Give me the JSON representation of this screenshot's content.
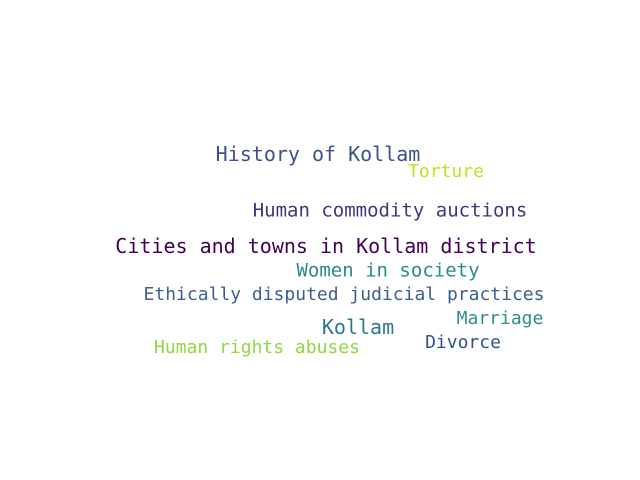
{
  "word_cloud": {
    "words": [
      {
        "text": "History of Kollam",
        "color": "#3b528b"
      },
      {
        "text": "Torture",
        "color": "#c2df23"
      },
      {
        "text": "Human commodity auctions",
        "color": "#46327e"
      },
      {
        "text": "Cities and towns in Kollam district",
        "color": "#440154"
      },
      {
        "text": "Women in society",
        "color": "#2c8a8c"
      },
      {
        "text": "Ethically disputed judicial practices",
        "color": "#3e5e8c"
      },
      {
        "text": "Kollam",
        "color": "#2a788e"
      },
      {
        "text": "Marriage",
        "color": "#2e8f8a"
      },
      {
        "text": "Human rights abuses",
        "color": "#8fd744"
      },
      {
        "text": "Divorce",
        "color": "#31538b"
      }
    ]
  }
}
